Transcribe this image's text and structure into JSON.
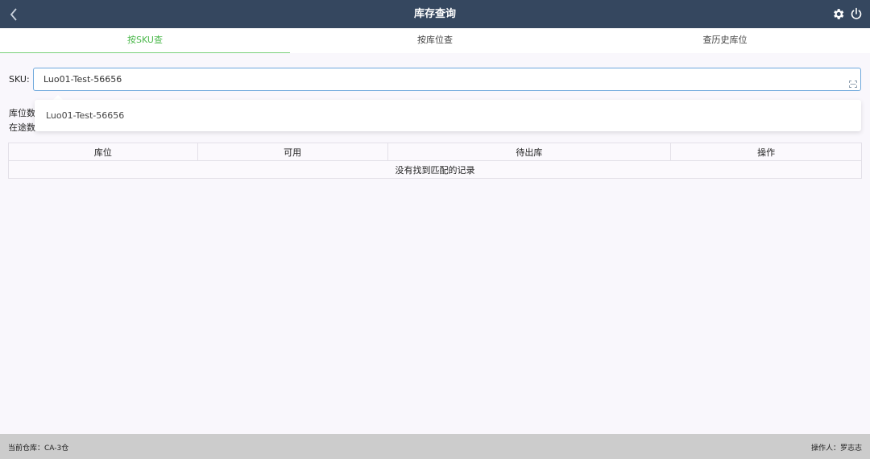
{
  "header": {
    "title": "库存查询"
  },
  "tabs": [
    {
      "label": "按SKU查",
      "active": true
    },
    {
      "label": "按库位查",
      "active": false
    },
    {
      "label": "查历史库位",
      "active": false
    }
  ],
  "search": {
    "label": "SKU:",
    "value": "Luo01-Test-56656"
  },
  "summary": {
    "location_count_label": "库位数",
    "in_transit_label": "在途数"
  },
  "autocomplete": {
    "items": [
      "Luo01-Test-56656"
    ]
  },
  "table": {
    "columns": [
      "库位",
      "可用",
      "待出库",
      "操作"
    ],
    "empty_text": "没有找到匹配的记录"
  },
  "footer": {
    "warehouse": "当前仓库：CA-3仓",
    "operator": "操作人：罗志志"
  },
  "colors": {
    "header_bg": "#35475f",
    "active_tab": "#4cb84c",
    "input_border": "#6fa8dc",
    "footer_bg": "#cccccc"
  }
}
